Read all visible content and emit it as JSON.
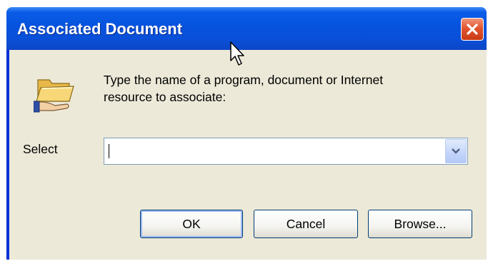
{
  "window": {
    "title": "Associated Document",
    "close_icon": "close-icon"
  },
  "dialog": {
    "icon": "open-folder-hand-icon",
    "prompt": "Type the name of a program, document or Internet\nresource to associate:",
    "select_label": "Select",
    "select_value": "",
    "dropdown_icon": "chevron-down-icon"
  },
  "buttons": {
    "ok": "OK",
    "cancel": "Cancel",
    "browse": "Browse..."
  },
  "colors": {
    "titlebar": "#0553de",
    "client_bg": "#ece9d8",
    "close_red": "#e2552f"
  }
}
